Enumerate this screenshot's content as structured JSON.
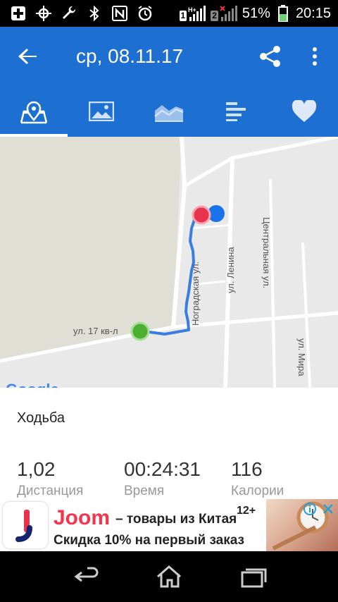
{
  "status_bar": {
    "battery_percent": "51%",
    "time": "20:15",
    "sim1": "1",
    "sim2": "2",
    "network_type": "H+",
    "icons": [
      "plus-icon",
      "gps-icon",
      "wrench-icon",
      "bluetooth-icon",
      "nfc-icon",
      "alarm-icon",
      "signal-icon",
      "battery-icon"
    ]
  },
  "app_bar": {
    "title": "ср, 08.11.17",
    "back_icon": "arrow-back-icon",
    "share_icon": "share-icon",
    "more_icon": "more-vert-icon"
  },
  "tabs": [
    {
      "icon": "map-icon",
      "active": true
    },
    {
      "icon": "image-icon",
      "active": false
    },
    {
      "icon": "chart-area-icon",
      "active": false
    },
    {
      "icon": "bars-icon",
      "active": false
    },
    {
      "icon": "heart-icon",
      "active": false
    }
  ],
  "map": {
    "streets": {
      "street_1": "ул. 17 кв-л",
      "street_2": "Ноградская ул.",
      "street_3": "ул. Ленина",
      "street_4": "Центральная ул.",
      "street_5": "ул. Мира"
    },
    "attribution": "Google"
  },
  "activity": {
    "type": "Ходьба",
    "stats": [
      {
        "value": "1,02",
        "label": "Дистанция"
      },
      {
        "value": "00:24:31",
        "label": "Время"
      },
      {
        "value": "116",
        "label": "Калории"
      }
    ]
  },
  "ad": {
    "brand": "Joom",
    "line1": "– товары из Китая",
    "line2": "Скидка 10% на первый заказ",
    "age_rating": "12+"
  },
  "colors": {
    "primary": "#1e6fd2",
    "route": "#3a7de0",
    "start_marker": "#4caf32",
    "end_marker": "#e8334f",
    "location_dot": "#1a73e8",
    "ad_brand": "#f4364c"
  }
}
